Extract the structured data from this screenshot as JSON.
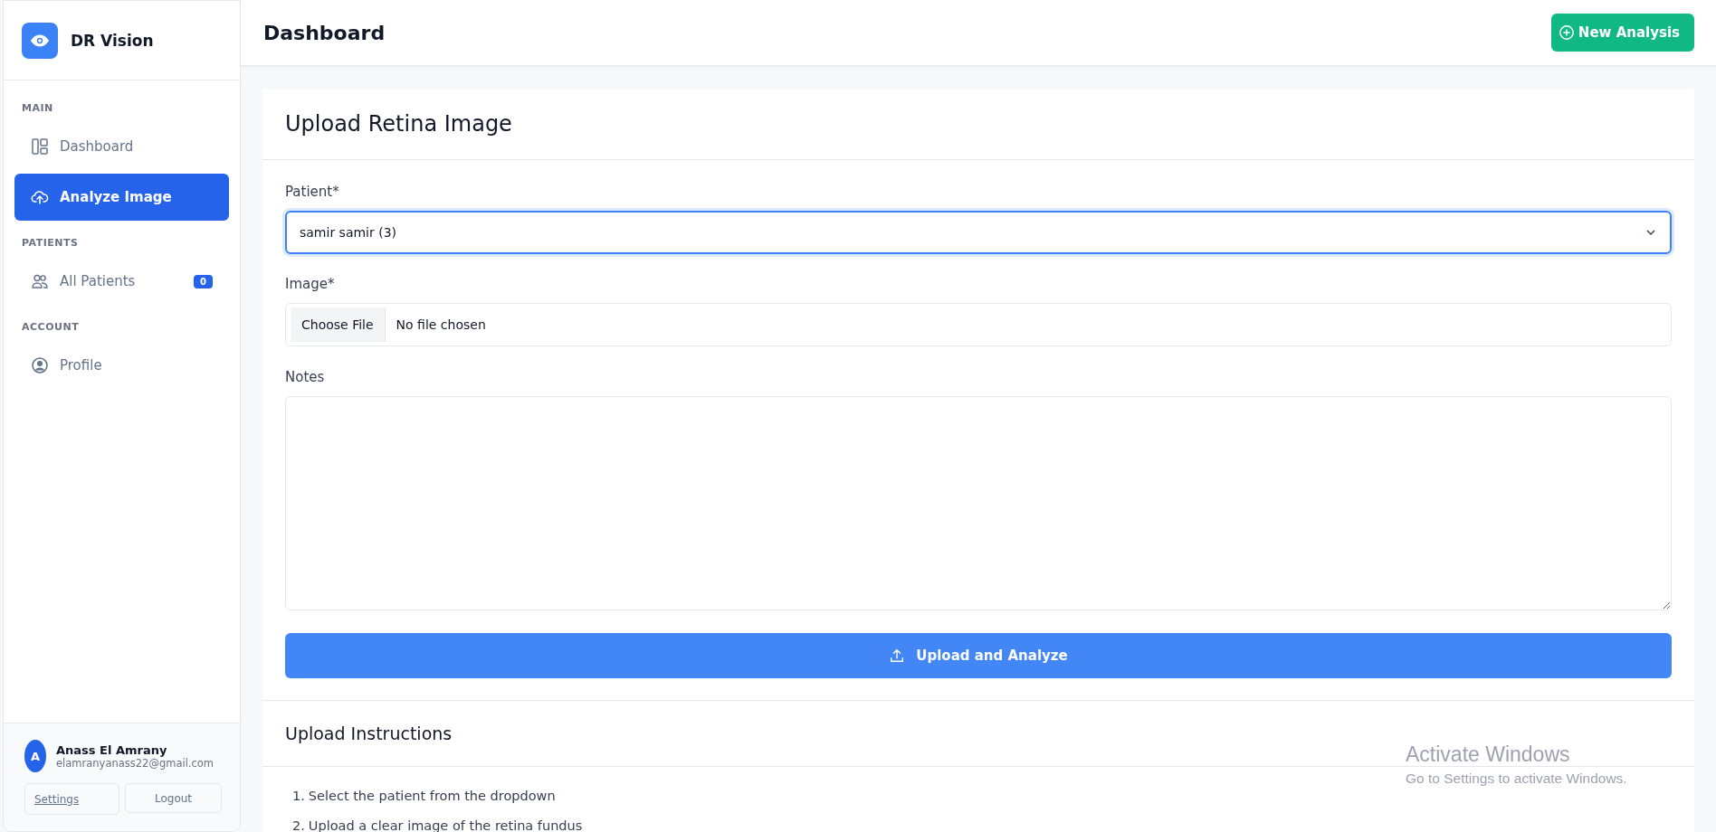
{
  "sidebar": {
    "brand": "DR Vision",
    "sections": [
      {
        "title": "MAIN",
        "items": [
          {
            "label": "Dashboard",
            "kind": "layout",
            "selected": false
          },
          {
            "label": "Analyze Image",
            "kind": "upload",
            "selected": true
          }
        ]
      },
      {
        "title": "PATIENTS",
        "items": [
          {
            "label": "All Patients",
            "kind": "users",
            "selected": false,
            "badge": "0"
          }
        ]
      },
      {
        "title": "ACCOUNT",
        "items": [
          {
            "label": "Profile",
            "kind": "person",
            "selected": false
          }
        ]
      }
    ],
    "user": {
      "initial": "A",
      "name": "Anass El Amrany",
      "email": "elamranyanass22@gmail.com",
      "settings": "Settings",
      "logout": "Logout"
    }
  },
  "header": {
    "title": "Dashboard",
    "action": "New Analysis"
  },
  "form": {
    "title": "Upload Retina Image",
    "patient": {
      "label": "Patient*",
      "value": "samir samir (3)",
      "focused": true
    },
    "image": {
      "label": "Image*",
      "button": "Choose File",
      "status": "No file chosen"
    },
    "notes": {
      "label": "Notes"
    },
    "submit": "Upload and Analyze"
  },
  "instructions": {
    "title": "Upload Instructions",
    "items": [
      {
        "number": "1.",
        "text": "Select the patient from the dropdown"
      },
      {
        "number": "2.",
        "text": "Upload a clear image of the retina fundus"
      }
    ]
  },
  "os_overlay": {
    "title": "Activate Windows",
    "subtitle": "Go to Settings to activate Windows."
  }
}
